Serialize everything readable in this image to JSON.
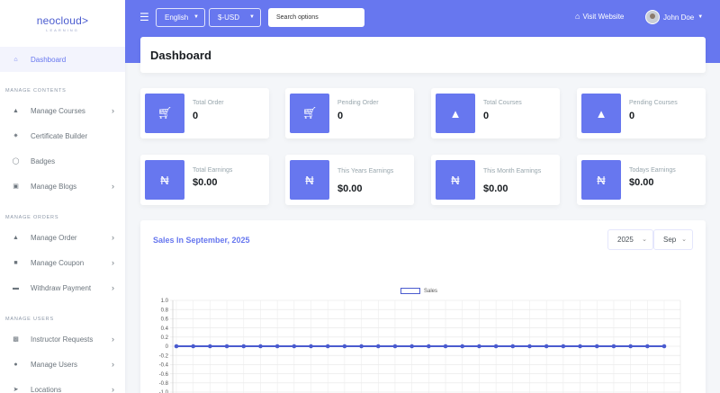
{
  "brand": {
    "name": "neocloud>",
    "tagline": "LEARNING"
  },
  "sidebar": {
    "active": {
      "label": "Dashboard",
      "icon": "home-icon"
    },
    "sections": [
      {
        "header": "MANAGE CONTENTS",
        "items": [
          {
            "label": "Manage Courses",
            "icon": "graduation-cap-icon",
            "has_submenu": true
          },
          {
            "label": "Certificate Builder",
            "icon": "certificate-icon",
            "has_submenu": false
          },
          {
            "label": "Badges",
            "icon": "badge-icon",
            "has_submenu": false
          },
          {
            "label": "Manage Blogs",
            "icon": "newspaper-icon",
            "has_submenu": true
          }
        ]
      },
      {
        "header": "MANAGE ORDERS",
        "items": [
          {
            "label": "Manage Order",
            "icon": "shopping-bag-icon",
            "has_submenu": true
          },
          {
            "label": "Manage Coupon",
            "icon": "ticket-icon",
            "has_submenu": true
          },
          {
            "label": "Withdraw Payment",
            "icon": "hand-money-icon",
            "has_submenu": true
          }
        ]
      },
      {
        "header": "MANAGE USERS",
        "items": [
          {
            "label": "Instructor Requests",
            "icon": "user-request-icon",
            "has_submenu": true
          },
          {
            "label": "Manage Users",
            "icon": "users-icon",
            "has_submenu": true
          },
          {
            "label": "Locations",
            "icon": "location-arrow-icon",
            "has_submenu": true
          }
        ]
      }
    ]
  },
  "topbar": {
    "language": "English",
    "currency": "$-USD",
    "search_placeholder": "Search options",
    "visit_label": "Visit Website",
    "user_name": "John Doe",
    "accent": "#6777ef"
  },
  "page_title": "Dashboard",
  "stats": [
    {
      "label": "Total Order",
      "value": "0",
      "icon": "cart-icon"
    },
    {
      "label": "Pending Order",
      "value": "0",
      "icon": "cart-icon"
    },
    {
      "label": "Total Courses",
      "value": "0",
      "icon": "graduation-cap-icon"
    },
    {
      "label": "Pending Courses",
      "value": "0",
      "icon": "graduation-cap-icon"
    },
    {
      "label": "Total Earnings",
      "value": "$0.00",
      "icon": "naira-icon"
    },
    {
      "label": "This Years Earnings",
      "value": "$0.00",
      "icon": "naira-icon"
    },
    {
      "label": "This Month Earnings",
      "value": "$0.00",
      "icon": "naira-icon"
    },
    {
      "label": "Todays Earnings",
      "value": "$0.00",
      "icon": "naira-icon"
    }
  ],
  "sales": {
    "title": "Sales In September, 2025",
    "year": "2025",
    "month": "Sep"
  },
  "chart_data": {
    "type": "line",
    "title": "",
    "xlabel": "",
    "ylabel": "",
    "series": [
      {
        "name": "Sales",
        "color": "#4a5bcf",
        "values": [
          0,
          0,
          0,
          0,
          0,
          0,
          0,
          0,
          0,
          0,
          0,
          0,
          0,
          0,
          0,
          0,
          0,
          0,
          0,
          0,
          0,
          0,
          0,
          0,
          0,
          0,
          0,
          0,
          0,
          0
        ]
      }
    ],
    "y_ticks": [
      "1.0",
      "0.8",
      "0.6",
      "0.4",
      "0.2",
      "0",
      "-0.2",
      "-0.4",
      "-0.6",
      "-0.8",
      "-1.0"
    ],
    "ylim": [
      -1,
      1
    ],
    "grid": true,
    "legend": "top-center"
  }
}
